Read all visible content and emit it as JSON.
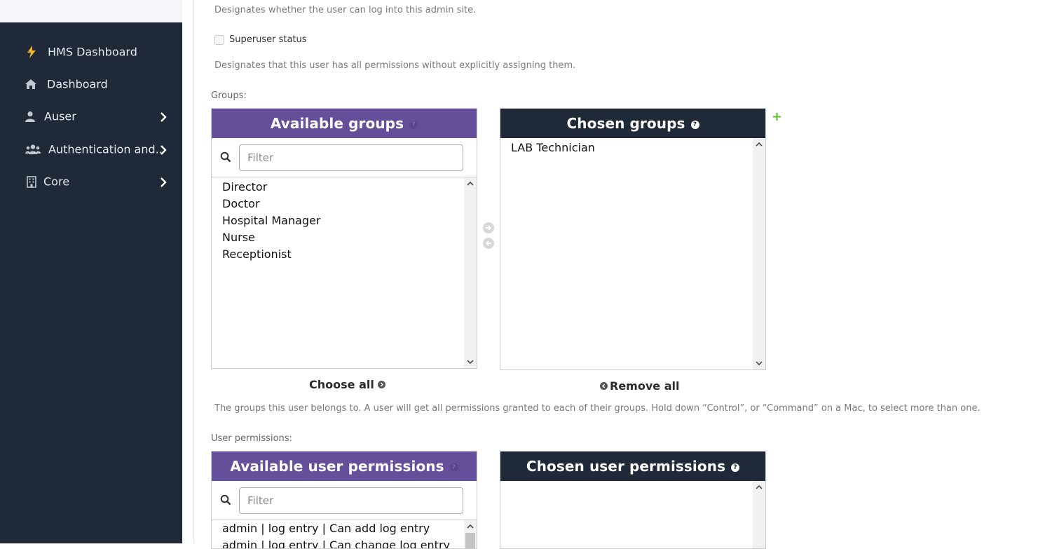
{
  "sidebar": {
    "items": [
      {
        "label": "HMS Dashboard",
        "icon": "bolt-icon"
      },
      {
        "label": "Dashboard",
        "icon": "home-icon"
      },
      {
        "label": "Auser",
        "icon": "user-icon"
      },
      {
        "label": "Authentication and..",
        "icon": "users-icon"
      },
      {
        "label": "Core",
        "icon": "building-icon"
      }
    ]
  },
  "form": {
    "staff_help": "Designates whether the user can log into this admin site.",
    "superuser_label": "Superuser status",
    "superuser_checked": false,
    "superuser_help": "Designates that this user has all permissions without explicitly assigning them.",
    "groups_label": "Groups:",
    "groups": {
      "available_title": "Available groups",
      "chosen_title": "Chosen groups",
      "filter_placeholder": "Filter",
      "available": [
        "Director",
        "Doctor",
        "Hospital Manager",
        "Nurse",
        "Receptionist"
      ],
      "chosen": [
        "LAB Technician"
      ],
      "choose_all": "Choose all",
      "remove_all": "Remove all",
      "help": "The groups this user belongs to. A user will get all permissions granted to each of their groups. Hold down “Control”, or “Command” on a Mac, to select more than one."
    },
    "permissions_label": "User permissions:",
    "permissions": {
      "available_title": "Available user permissions",
      "chosen_title": "Chosen user permissions",
      "filter_placeholder": "Filter",
      "available": [
        "admin | log entry | Can add log entry",
        "admin | log entry | Can change log entry"
      ],
      "chosen": []
    }
  },
  "colors": {
    "sidebar_bg": "#1f2937",
    "available_header": "#654f9b",
    "chosen_header": "#1f2937",
    "add_plus": "#5fbf2a"
  }
}
